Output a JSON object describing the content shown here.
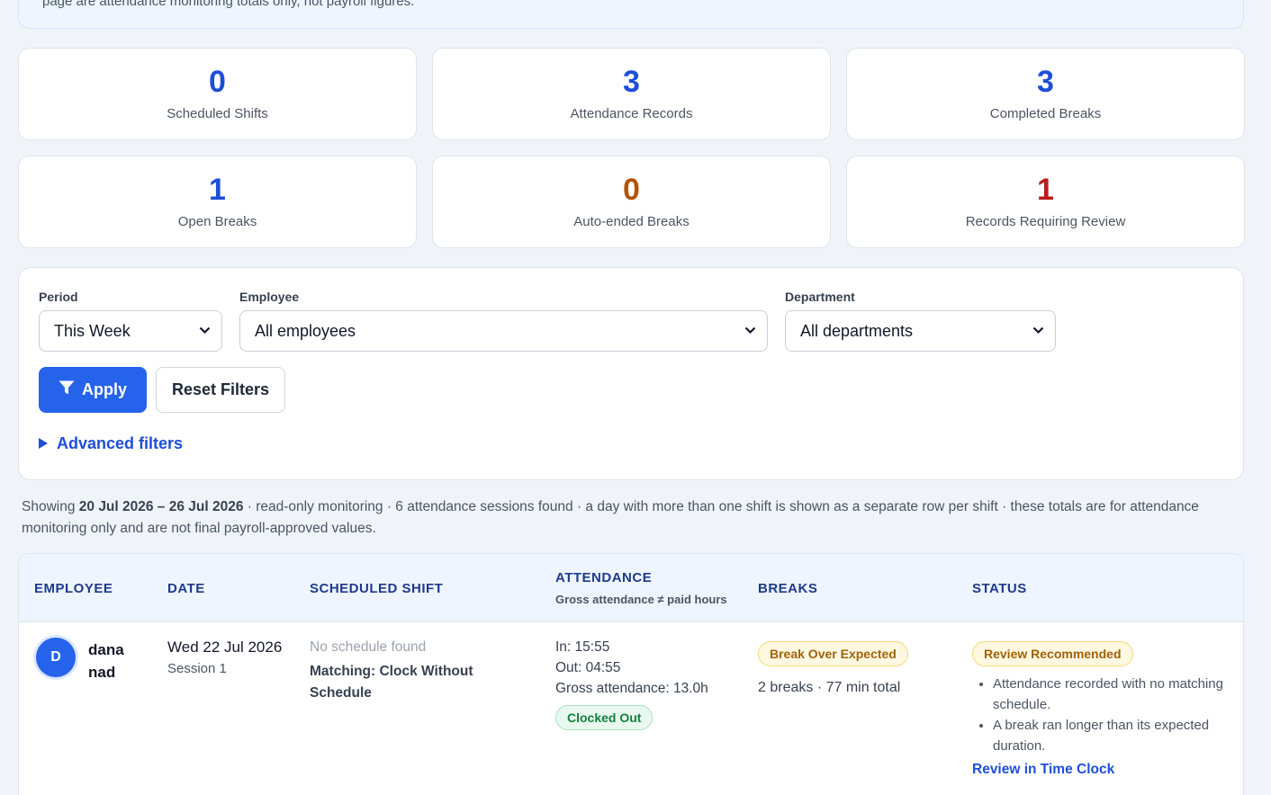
{
  "notice": {
    "text": "page are attendance monitoring totals only, not payroll figures."
  },
  "stats": [
    {
      "value": "0",
      "label": "Scheduled Shifts",
      "color": "#1d4ed8"
    },
    {
      "value": "3",
      "label": "Attendance Records",
      "color": "#1d4ed8"
    },
    {
      "value": "3",
      "label": "Completed Breaks",
      "color": "#1d4ed8"
    },
    {
      "value": "1",
      "label": "Open Breaks",
      "color": "#1d4ed8"
    },
    {
      "value": "0",
      "label": "Auto-ended Breaks",
      "color": "#b45309"
    },
    {
      "value": "1",
      "label": "Records Requiring Review",
      "color": "#b91c1c"
    }
  ],
  "filters": {
    "period_label": "Period",
    "period_value": "This Week",
    "employee_label": "Employee",
    "employee_value": "All employees",
    "department_label": "Department",
    "department_value": "All departments",
    "apply_label": "Apply",
    "reset_label": "Reset Filters",
    "advanced_label": "Advanced filters"
  },
  "summary": {
    "prefix": "Showing ",
    "range": "20 Jul 2026 – 26 Jul 2026",
    "rest": " · read-only monitoring · 6 attendance sessions found · a day with more than one shift is shown as a separate row per shift · these totals are for attendance monitoring only and are not final payroll-approved values."
  },
  "table": {
    "headers": {
      "employee": "EMPLOYEE",
      "date": "DATE",
      "shift": "SCHEDULED SHIFT",
      "attendance": "ATTENDANCE",
      "attendance_sub": "Gross attendance ≠ paid hours",
      "breaks": "BREAKS",
      "status": "STATUS"
    },
    "rows": [
      {
        "avatar": "D",
        "name": "dana nad",
        "date": "Wed 22 Jul 2026",
        "session": "Session 1",
        "shift_none": "No schedule found",
        "shift_match": "Matching: Clock Without Schedule",
        "in": "In: 15:55",
        "out": "Out: 04:55",
        "gross": "Gross attendance: 13.0h",
        "att_badge": "Clocked Out",
        "break_badge": "Break Over Expected",
        "break_summary": "2 breaks · 77 min total",
        "status_badge": "Review Recommended",
        "reasons": [
          "Attendance recorded with no matching schedule.",
          "A break ran longer than its expected duration."
        ],
        "link": "Review in Time Clock"
      }
    ]
  }
}
